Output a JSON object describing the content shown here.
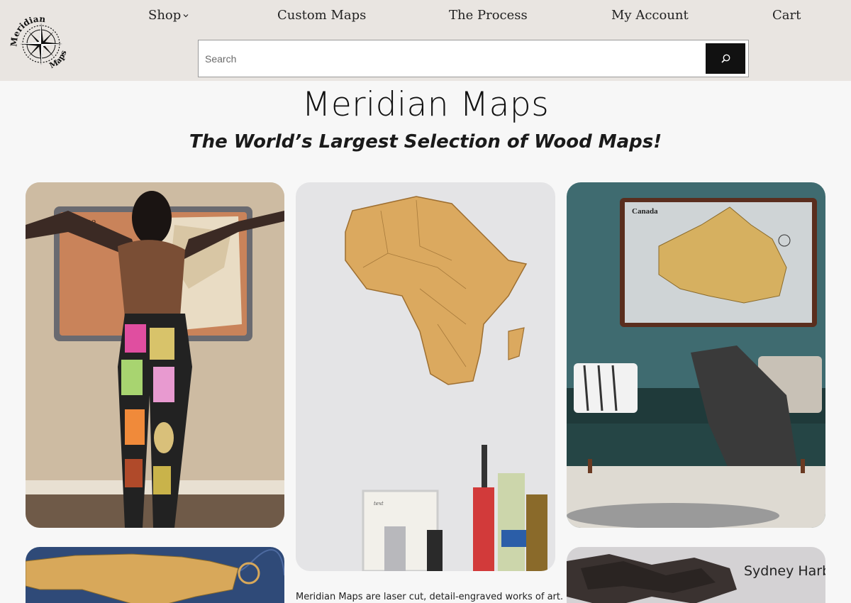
{
  "brand": {
    "logo_arc_top": "Meridian",
    "logo_arc_bottom": "Maps"
  },
  "nav": {
    "items": [
      {
        "label": "Shop",
        "has_dropdown": true
      },
      {
        "label": "Custom Maps"
      },
      {
        "label": "The Process"
      },
      {
        "label": "My Account"
      },
      {
        "label": "Cart"
      }
    ]
  },
  "search": {
    "placeholder": "Search",
    "value": "",
    "button_icon": "search-icon"
  },
  "hero": {
    "title": "Meridian Maps",
    "subtitle": "The World’s Largest Selection of Wood Maps!"
  },
  "gallery": {
    "items": [
      {
        "map_label": "Europe"
      },
      {
        "map_label": ""
      },
      {
        "map_label": "Canada"
      },
      {
        "map_label": ""
      },
      {
        "map_label": "Sydney Harbour"
      }
    ]
  },
  "description": {
    "text": "Meridian Maps are laser cut, detail-engraved works of art."
  },
  "colors": {
    "header_bg": "#e9e5e1",
    "page_bg": "#f7f7f7",
    "search_button": "#111111"
  }
}
